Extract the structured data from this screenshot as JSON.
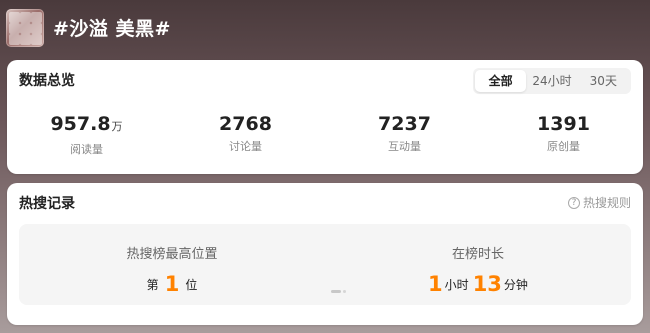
{
  "topic": {
    "title": "#沙溢 美黑#"
  },
  "overview": {
    "title": "数据总览",
    "tabs": [
      {
        "label": "全部",
        "active": true
      },
      {
        "label": "24小时",
        "active": false
      },
      {
        "label": "30天",
        "active": false
      }
    ],
    "stats": [
      {
        "value": "957.8",
        "unit": "万",
        "label": "阅读量"
      },
      {
        "value": "2768",
        "unit": "",
        "label": "讨论量"
      },
      {
        "value": "7237",
        "unit": "",
        "label": "互动量"
      },
      {
        "value": "1391",
        "unit": "",
        "label": "原创量"
      }
    ]
  },
  "hot_search": {
    "title": "热搜记录",
    "rules_link": "热搜规则",
    "rules_icon": "question-circle-icon",
    "highest_position": {
      "label": "热搜榜最高位置",
      "prefix": "第",
      "value": "1",
      "suffix": "位"
    },
    "duration": {
      "label": "在榜时长",
      "hours": "1",
      "hours_unit": "小时",
      "minutes": "13",
      "minutes_unit": "分钟"
    }
  },
  "colors": {
    "accent": "#ff8200",
    "card": "#ffffff",
    "panel": "#f5f5f5"
  }
}
